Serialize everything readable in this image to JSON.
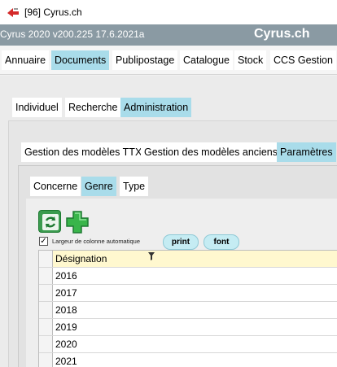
{
  "window": {
    "title": "[96] Cyrus.ch"
  },
  "appbar": {
    "version": "Cyrus 2020 v200.225 17.6.2021a",
    "brand": "Cyrus.ch"
  },
  "menu": {
    "items": [
      {
        "label": "Annuaire"
      },
      {
        "label": "Documents"
      },
      {
        "label": "Publipostage"
      },
      {
        "label": "Catalogue"
      },
      {
        "label": "Stock"
      },
      {
        "label": "CCS Gestion"
      }
    ],
    "active": "Documents"
  },
  "level1_tabs": {
    "items": [
      {
        "label": "Individuel"
      },
      {
        "label": "Recherche"
      },
      {
        "label": "Administration"
      }
    ],
    "active": "Administration"
  },
  "level2_tabs": {
    "items": [
      {
        "label": "Gestion des modèles TTX"
      },
      {
        "label": "Gestion des modèles anciens"
      },
      {
        "label": "Paramètres"
      }
    ],
    "active": "Paramètres"
  },
  "level3_tabs": {
    "items": [
      {
        "label": "Concerne"
      },
      {
        "label": "Genre"
      },
      {
        "label": "Type"
      }
    ],
    "active": "Genre"
  },
  "toolbar": {
    "refresh_icon": "refresh-icon",
    "add_icon": "plus-icon",
    "autowidth_label": "Largeur de colonne automatique",
    "autowidth_checked": true,
    "print_label": "print",
    "font_label": "font"
  },
  "grid": {
    "column_header": "Désignation",
    "filter_icon": "filter-icon",
    "rows": [
      "2016",
      "2017",
      "2018",
      "2019",
      "2020",
      "2021"
    ]
  },
  "colors": {
    "accent": "#a9dcea",
    "appbar": "#8a9aa3",
    "header_row": "#fff8cf",
    "pill": "#c5ecf3"
  }
}
